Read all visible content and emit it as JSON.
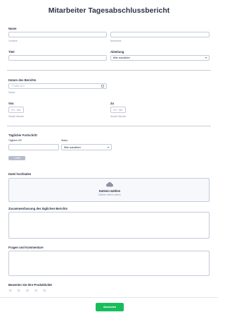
{
  "form": {
    "title": "Mitarbeiter Tagesabschlussbericht",
    "name_label": "Name",
    "first_name_sublabel": "Vorname",
    "last_name_sublabel": "Nachname",
    "title_label": "Titel",
    "department_label": "Abteilung",
    "department_placeholder": "Bitte auswählen",
    "date_label": "Datum des Berichts",
    "date_placeholder": "TT-MM-JJJJ",
    "date_sublabel": "Datum",
    "from_label": "Von",
    "from_placeholder": "HH : MM",
    "from_sublabel": "Stunde Minuten",
    "to_label": "Zu",
    "to_placeholder": "HH : MM",
    "to_sublabel": "Stunde Minuten",
    "progress_label": "Täglicher Fortschritt",
    "progress_col_task": "Täglicher KPI",
    "progress_col_status": "Status",
    "progress_status_placeholder": "Bitte auswählen",
    "progress_add_button": "+ Zeile hinzufügen",
    "upload_label": "Datei hochladen",
    "upload_button": "Dateien wählen",
    "upload_hint": "Dateien hierhin ziehen",
    "summary_label": "Zusammenfassung des täglichen Berichts",
    "questions_label": "Fragen und Kommentare",
    "rating_label": "Bewerten Sie Ihre Produktivität",
    "rating_stars": [
      "★",
      "★",
      "★",
      "★",
      "★"
    ],
    "submit_button": "Absenden"
  },
  "colors": {
    "submit": "#18bd5b",
    "border": "#c3cad8",
    "star_empty": "#d9dce5"
  }
}
